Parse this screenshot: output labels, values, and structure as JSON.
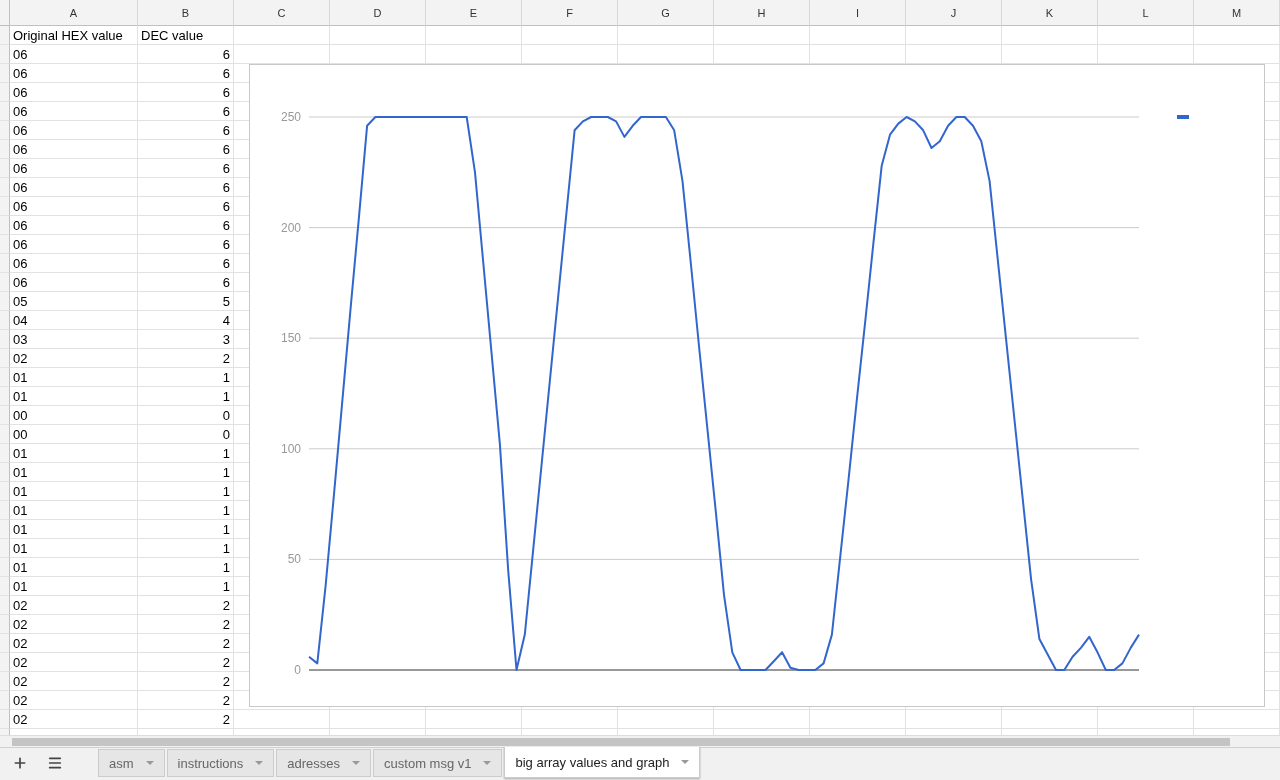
{
  "sheet": {
    "columns": [
      "A",
      "B",
      "C",
      "D",
      "E",
      "F",
      "G",
      "H",
      "I",
      "J",
      "K",
      "L",
      "M"
    ],
    "header": {
      "a": "Original HEX value",
      "b": "DEC value"
    },
    "rows": [
      {
        "a": "06",
        "b": "6"
      },
      {
        "a": "06",
        "b": "6"
      },
      {
        "a": "06",
        "b": "6"
      },
      {
        "a": "06",
        "b": "6"
      },
      {
        "a": "06",
        "b": "6"
      },
      {
        "a": "06",
        "b": "6"
      },
      {
        "a": "06",
        "b": "6"
      },
      {
        "a": "06",
        "b": "6"
      },
      {
        "a": "06",
        "b": "6"
      },
      {
        "a": "06",
        "b": "6"
      },
      {
        "a": "06",
        "b": "6"
      },
      {
        "a": "06",
        "b": "6"
      },
      {
        "a": "06",
        "b": "6"
      },
      {
        "a": "05",
        "b": "5"
      },
      {
        "a": "04",
        "b": "4"
      },
      {
        "a": "03",
        "b": "3"
      },
      {
        "a": "02",
        "b": "2"
      },
      {
        "a": "01",
        "b": "1"
      },
      {
        "a": "01",
        "b": "1"
      },
      {
        "a": "00",
        "b": "0"
      },
      {
        "a": "00",
        "b": "0"
      },
      {
        "a": "01",
        "b": "1"
      },
      {
        "a": "01",
        "b": "1"
      },
      {
        "a": "01",
        "b": "1"
      },
      {
        "a": "01",
        "b": "1"
      },
      {
        "a": "01",
        "b": "1"
      },
      {
        "a": "01",
        "b": "1"
      },
      {
        "a": "01",
        "b": "1"
      },
      {
        "a": "01",
        "b": "1"
      },
      {
        "a": "02",
        "b": "2"
      },
      {
        "a": "02",
        "b": "2"
      },
      {
        "a": "02",
        "b": "2"
      },
      {
        "a": "02",
        "b": "2"
      },
      {
        "a": "02",
        "b": "2"
      },
      {
        "a": "02",
        "b": "2"
      },
      {
        "a": "02",
        "b": "2"
      }
    ]
  },
  "chart": {
    "chart_data": {
      "type": "line",
      "grid": true,
      "ylim": [
        0,
        250
      ],
      "yticks": [
        0,
        50,
        100,
        150,
        200,
        250
      ],
      "categories": [
        null,
        null,
        null,
        null,
        null,
        null,
        null,
        null,
        null,
        null,
        null,
        null,
        null,
        null,
        null,
        null,
        null,
        null,
        null,
        null,
        null,
        null,
        null,
        null,
        null,
        null,
        null,
        null,
        null,
        null,
        null,
        null,
        null,
        null,
        null,
        null,
        null,
        null,
        null,
        null,
        null,
        null,
        null,
        null,
        null,
        null,
        null,
        null,
        null,
        null,
        null,
        null,
        null,
        null,
        null,
        null,
        null,
        null,
        null,
        null,
        null,
        null,
        null,
        null,
        null,
        null,
        null,
        null,
        null,
        null,
        null,
        null,
        null,
        null,
        null,
        null,
        null,
        null,
        null,
        null,
        null,
        null,
        null,
        null,
        null,
        null,
        null,
        null,
        null,
        null,
        null,
        null,
        null,
        null,
        null,
        null,
        null,
        null,
        null,
        null,
        null
      ],
      "series": [
        {
          "color": "#3366cc",
          "values": [
            6,
            3,
            38,
            79,
            121,
            163,
            204,
            246,
            250,
            250,
            250,
            250,
            250,
            250,
            250,
            250,
            250,
            250,
            250,
            250,
            225,
            184,
            143,
            102,
            45,
            0,
            16,
            54,
            92,
            130,
            168,
            206,
            244,
            248,
            250,
            250,
            250,
            248,
            241,
            246,
            250,
            250,
            250,
            250,
            244,
            221,
            184,
            146,
            109,
            72,
            34,
            8,
            0,
            0,
            0,
            0,
            4,
            8,
            1,
            0,
            0,
            0,
            3,
            16,
            51,
            86,
            122,
            157,
            193,
            228,
            242,
            247,
            250,
            248,
            244,
            236,
            239,
            246,
            250,
            250,
            246,
            239,
            221,
            185,
            149,
            113,
            77,
            41,
            14,
            7,
            0,
            0,
            6,
            10,
            15,
            8,
            0,
            0,
            3,
            10,
            16
          ]
        }
      ]
    }
  },
  "tabs": [
    {
      "label": "asm",
      "selected": false
    },
    {
      "label": "instructions",
      "selected": false
    },
    {
      "label": "adresses",
      "selected": false
    },
    {
      "label": "custom msg v1",
      "selected": false
    },
    {
      "label": "big array values and graph",
      "selected": true
    }
  ]
}
